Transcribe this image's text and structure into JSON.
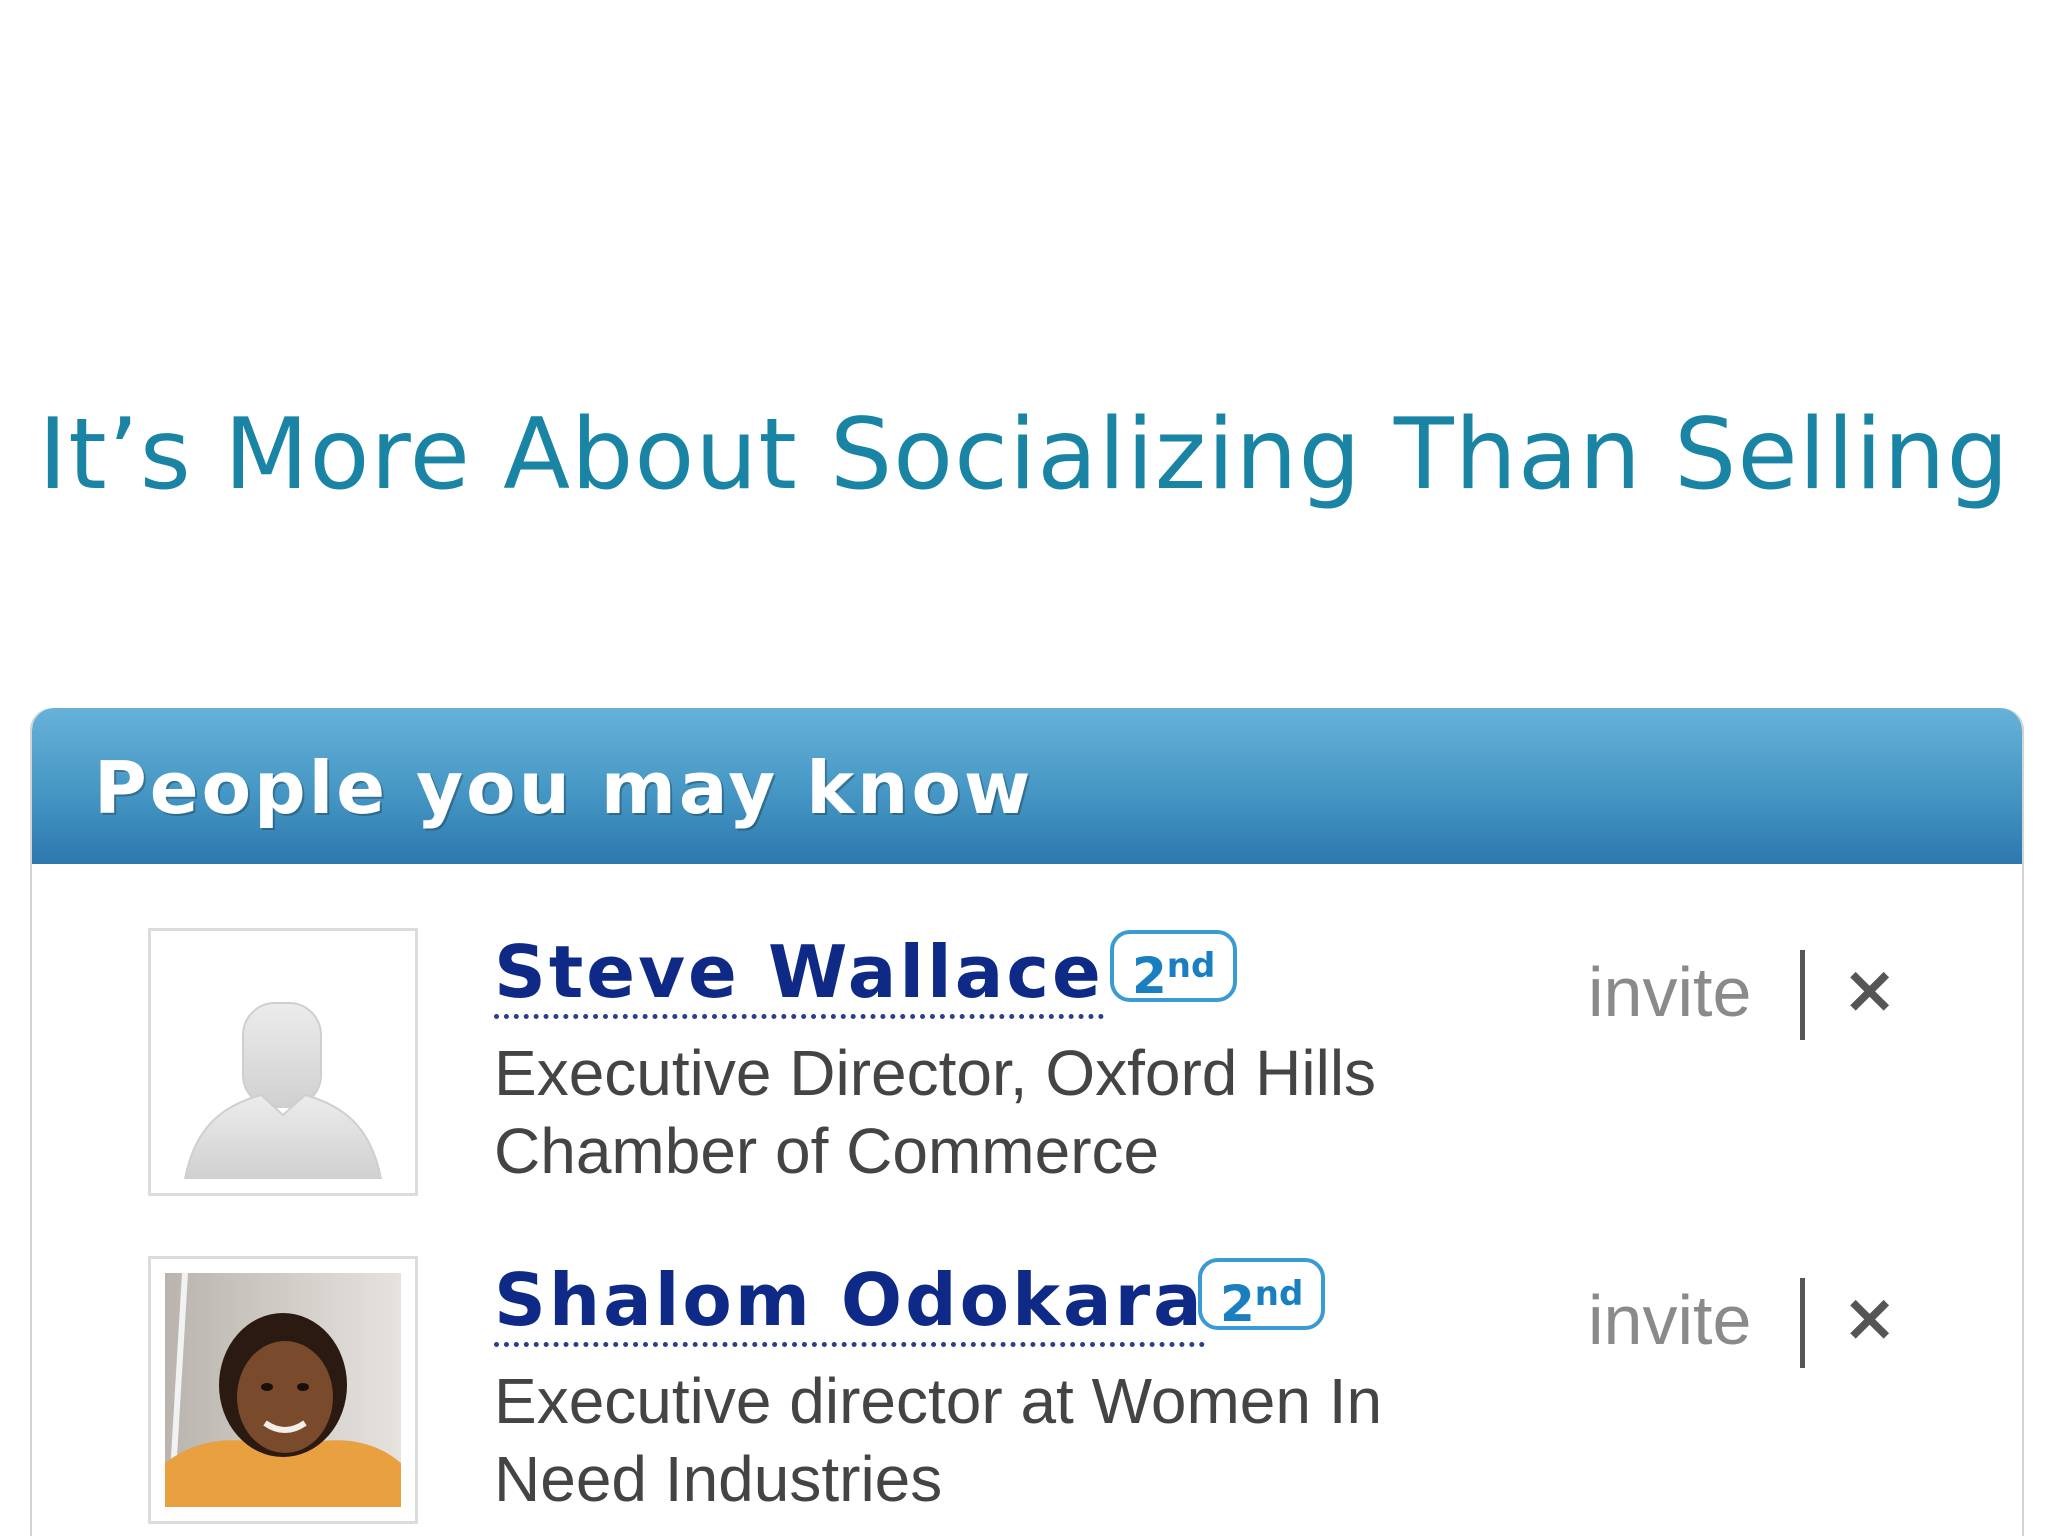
{
  "slide": {
    "title": "It’s More About Socializing Than Selling"
  },
  "widget": {
    "header_title": "People you may know",
    "header_gradient": [
      "#66b2d9",
      "#2c79ad"
    ],
    "people": [
      {
        "name": "Steve Wallace",
        "degree": "2",
        "degree_suffix": "nd",
        "title": "Executive Director, Oxford Hills Chamber of Commerce",
        "invite_label": "invite",
        "dismiss_label": "×",
        "avatar": "default-silhouette"
      },
      {
        "name": "Shalom Odokara",
        "degree": "2",
        "degree_suffix": "nd",
        "title": "Executive director at Women In Need Industries",
        "invite_label": "invite",
        "dismiss_label": "×",
        "avatar": "profile-photo"
      }
    ]
  },
  "colors": {
    "title": "#1a84a5",
    "name": "#0e2a86",
    "badge": "#1a7fc0"
  }
}
